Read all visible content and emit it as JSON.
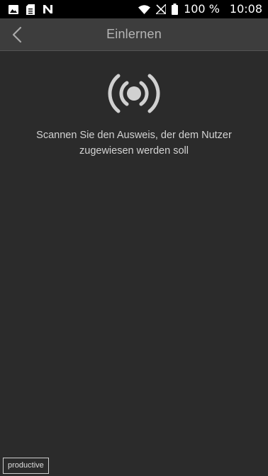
{
  "status_bar": {
    "icons_left": [
      "image-icon",
      "sd-card-icon",
      "nfc-n-icon"
    ],
    "icons_right": [
      "wifi-icon",
      "no-signal-icon",
      "battery-full-icon"
    ],
    "battery": "100 %",
    "time": "10:08"
  },
  "app_bar": {
    "back_icon": "chevron-left-icon",
    "title": "Einlernen"
  },
  "main": {
    "scan_icon": "nfc-broadcast-icon",
    "instruction": "Scannen Sie den Ausweis, der dem Nutzer zugewiesen werden soll"
  },
  "environment_badge": "productive",
  "colors": {
    "background": "#2b2b2b",
    "app_bar": "#3d3d3d",
    "status_bar": "#000000",
    "icon": "#d0d0d0"
  }
}
